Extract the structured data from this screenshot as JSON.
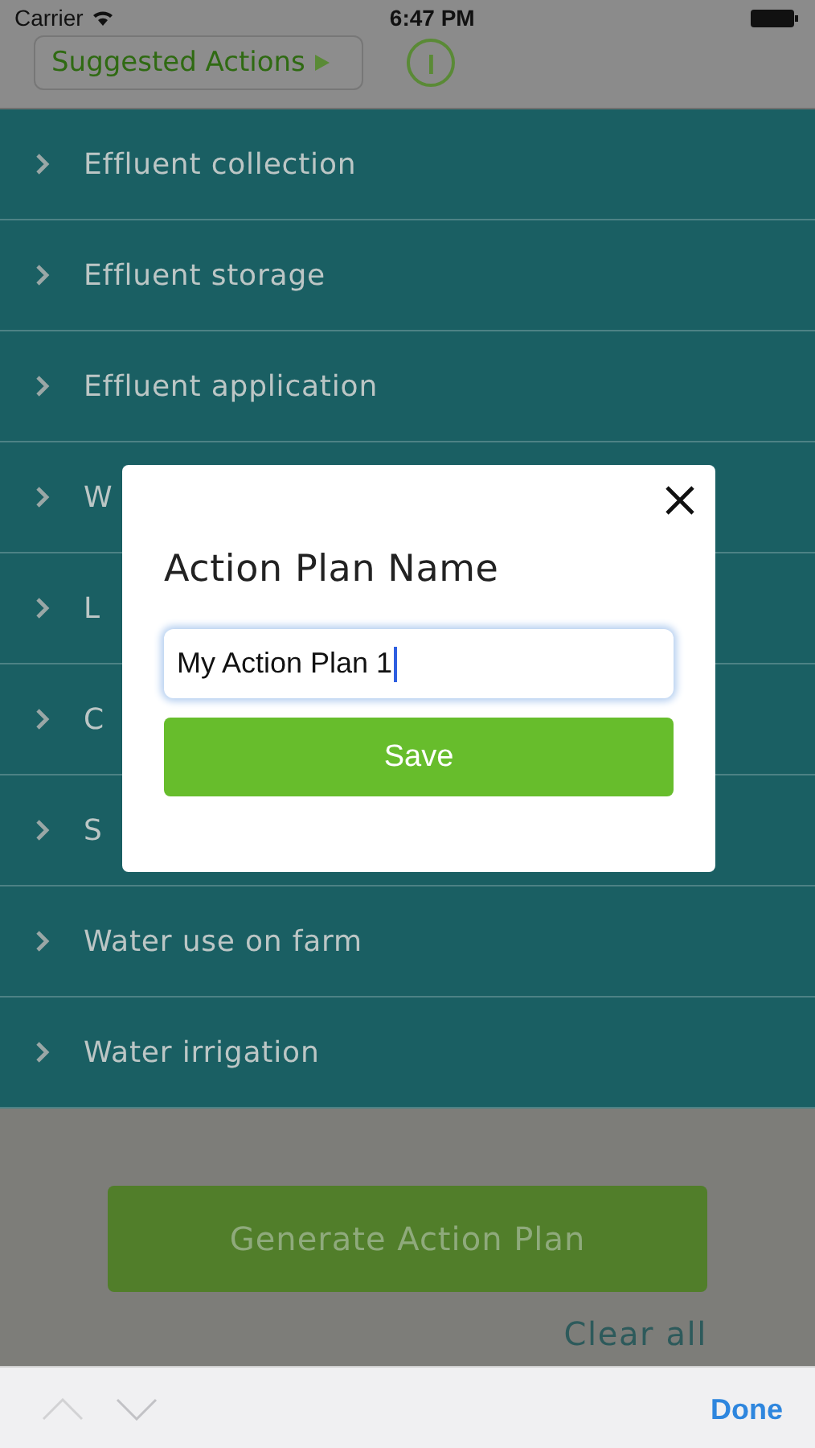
{
  "status_bar": {
    "carrier": "Carrier",
    "time": "6:47 PM"
  },
  "header": {
    "suggested_button": "Suggested Actions"
  },
  "categories": [
    {
      "label": "Effluent collection"
    },
    {
      "label": "Effluent storage"
    },
    {
      "label": "Effluent application"
    },
    {
      "label": "W"
    },
    {
      "label": "L"
    },
    {
      "label": "C"
    },
    {
      "label": "S"
    },
    {
      "label": "Water use on farm"
    },
    {
      "label": "Water irrigation"
    }
  ],
  "generate_button": "Generate Action Plan",
  "clear_all": "Clear all",
  "dialog": {
    "title": "Action Plan Name",
    "name_value": "My Action Plan 1",
    "save_button": "Save"
  },
  "keyboard_toolbar": {
    "done": "Done"
  }
}
